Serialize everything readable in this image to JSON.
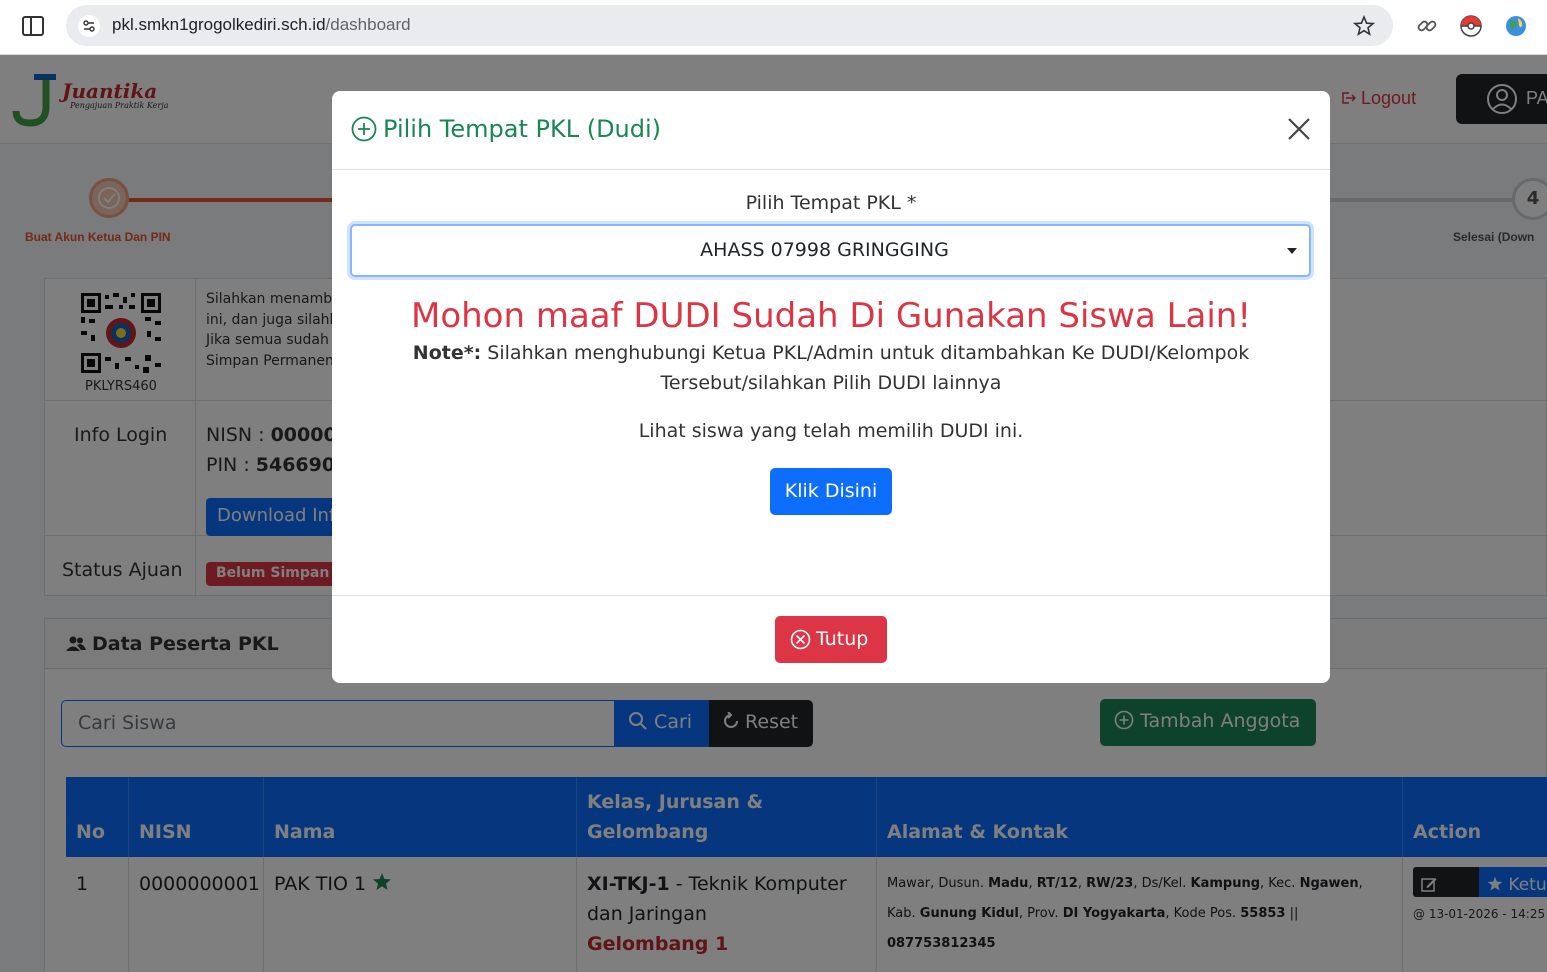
{
  "browser": {
    "url_host": "pkl.smkn1grogolkediri.sch.id",
    "url_path": "/dashboard"
  },
  "header": {
    "brand": "Juantika",
    "tagline": "Pengajuan Praktik Kerja",
    "logout": "Logout",
    "user": "PA"
  },
  "stepper": {
    "step1_label": "Buat Akun Ketua Dan PIN",
    "step4_number": "4",
    "step4_label": "Selesai (Down"
  },
  "info": {
    "qr_code_text": "PKLYRS460",
    "instructions": "Silahkan menambah\nini, dan juga silahka\nJika semua sudah la\nSimpan Permanen",
    "login_label": "Info Login",
    "nisn_label": "NISN : ",
    "nisn_value": "000000",
    "pin_label": "PIN : ",
    "pin_value": "546690",
    "download_button": "Download Info",
    "status_label": "Status Ajuan",
    "status_badge": "Belum Simpan P"
  },
  "peserta": {
    "title": "Data Peserta PKL",
    "search_placeholder": "Cari Siswa",
    "cari_button": "Cari",
    "reset_button": "Reset",
    "tambah_button": "Tambah Anggota",
    "columns": [
      "No",
      "NISN",
      "Nama",
      "Kelas, Jurusan & Gelombang",
      "Alamat & Kontak",
      "Action"
    ],
    "rows": [
      {
        "no": "1",
        "nisn": "0000000001",
        "nama": "PAK TIO 1",
        "kelas_code": "XI-TKJ-1",
        "kelas_rest": " - Teknik Komputer dan Jaringan",
        "gelombang": "Gelombang 1",
        "alamat_1": "Mawar, Dusun. ",
        "dusun": "Madu",
        "rt": "RT/12",
        "rw": "RW/23",
        "alamat_2": ", Ds/Kel. ",
        "desa": "Kampung",
        "alamat_3": ", Kec. ",
        "kec": "Ngawen",
        "alamat_4": ", Kab. ",
        "kab": "Gunung Kidul",
        "alamat_5": ", Prov. ",
        "prov": "DI Yogyakarta",
        "alamat_6": ", Kode Pos. ",
        "kodepos": "55853",
        "alamat_7": " || ",
        "phone": "087753812345",
        "edit": "Edit",
        "ketua": "Ketu",
        "timestamp": "@ 13-01-2026 - 14:25"
      }
    ]
  },
  "modal": {
    "title": "Pilih Tempat PKL (Dudi)",
    "select_label": "Pilih Tempat PKL *",
    "selected_value": "AHASS 07998 GRINGGING",
    "alert": "Mohon maaf DUDI Sudah Di Gunakan Siswa Lain!",
    "note_label": "Note*:",
    "note_text": " Silahkan menghubungi Ketua PKL/Admin untuk ditambahkan Ke DUDI/Kelompok Tersebut/silahkan Pilih DUDI lainnya",
    "lihat_text": "Lihat siswa yang telah memilih DUDI ini.",
    "klik_button": "Klik Disini",
    "tutup_button": "Tutup"
  },
  "colors": {
    "primary": "#0d6efd",
    "success": "#198754",
    "danger": "#dc3545",
    "dark": "#212529",
    "accent_orange": "#e8552a"
  },
  "icons": [
    "sidebar-toggle-icon",
    "tune-icon",
    "star-icon",
    "link-icon",
    "pokeball-icon",
    "globe-icon",
    "logout-icon",
    "user-circle-icon",
    "check-icon",
    "users-icon",
    "search-icon",
    "reset-icon",
    "plus-circle-icon",
    "star-filled-icon",
    "edit-icon",
    "close-icon",
    "x-circle-icon",
    "caret-down-icon"
  ]
}
